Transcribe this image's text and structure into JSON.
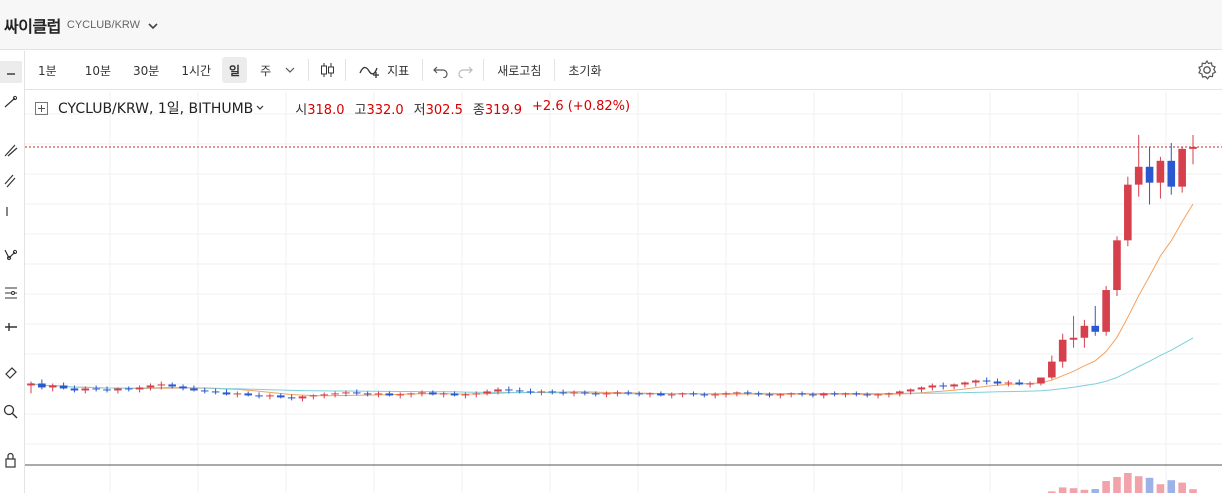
{
  "header": {
    "coin_name": "싸이클럽",
    "pair": "CYCLUB/KRW"
  },
  "toolbar": {
    "intervals": [
      "1분",
      "10분",
      "30분",
      "1시간",
      "일",
      "주"
    ],
    "active_interval": "일",
    "indicator_label": "지표",
    "refresh_label": "새로고침",
    "reset_label": "초기화"
  },
  "legend": {
    "symbol": "CYCLUB/KRW, 1일, BITHUMB",
    "open_label": "시",
    "open": "318.0",
    "high_label": "고",
    "high": "332.0",
    "low_label": "저",
    "low": "302.5",
    "close_label": "종",
    "close": "319.9",
    "change": "+2.6 (+0.82%)"
  },
  "colors": {
    "up": "#d5404c",
    "down": "#2a58d0",
    "ma_short": "#f4a261",
    "ma_long": "#7ecfdb",
    "price_line": "#c62828"
  },
  "chart_data": {
    "type": "candlestick",
    "title": "",
    "xlabel": "",
    "ylabel": "",
    "grid": true,
    "note": "daily OHLC, relative price levels (y axis not labeled in view)",
    "ylim": [
      0,
      340
    ],
    "last_close": 319.9,
    "candles": [
      [
        80,
        84,
        72,
        82
      ],
      [
        82,
        86,
        76,
        78
      ],
      [
        78,
        82,
        74,
        80
      ],
      [
        80,
        83,
        76,
        77
      ],
      [
        77,
        80,
        73,
        75
      ],
      [
        75,
        79,
        72,
        77
      ],
      [
        77,
        80,
        74,
        76
      ],
      [
        76,
        79,
        73,
        75
      ],
      [
        75,
        78,
        72,
        77
      ],
      [
        77,
        79,
        74,
        76
      ],
      [
        76,
        80,
        73,
        78
      ],
      [
        78,
        82,
        75,
        80
      ],
      [
        80,
        84,
        76,
        81
      ],
      [
        81,
        83,
        77,
        79
      ],
      [
        79,
        81,
        75,
        77
      ],
      [
        77,
        80,
        74,
        75
      ],
      [
        75,
        78,
        72,
        74
      ],
      [
        74,
        77,
        71,
        73
      ],
      [
        73,
        76,
        70,
        71
      ],
      [
        71,
        74,
        68,
        72
      ],
      [
        72,
        74,
        69,
        70
      ],
      [
        70,
        73,
        67,
        69
      ],
      [
        69,
        72,
        66,
        70
      ],
      [
        70,
        72,
        67,
        68
      ],
      [
        68,
        71,
        65,
        67
      ],
      [
        67,
        70,
        64,
        69
      ],
      [
        69,
        71,
        66,
        70
      ],
      [
        70,
        73,
        67,
        71
      ],
      [
        71,
        74,
        68,
        72
      ],
      [
        72,
        75,
        69,
        73
      ],
      [
        73,
        76,
        70,
        72
      ],
      [
        72,
        74,
        69,
        71
      ],
      [
        71,
        74,
        68,
        72
      ],
      [
        72,
        74,
        69,
        70
      ],
      [
        70,
        73,
        67,
        71
      ],
      [
        71,
        73,
        68,
        72
      ],
      [
        72,
        75,
        69,
        73
      ],
      [
        73,
        75,
        70,
        71
      ],
      [
        71,
        74,
        68,
        72
      ],
      [
        72,
        74,
        69,
        70
      ],
      [
        70,
        73,
        67,
        71
      ],
      [
        71,
        74,
        68,
        72
      ],
      [
        72,
        76,
        70,
        74
      ],
      [
        74,
        78,
        71,
        76
      ],
      [
        76,
        79,
        72,
        75
      ],
      [
        75,
        78,
        72,
        74
      ],
      [
        74,
        77,
        71,
        73
      ],
      [
        73,
        76,
        70,
        74
      ],
      [
        74,
        76,
        71,
        73
      ],
      [
        73,
        76,
        70,
        72
      ],
      [
        72,
        75,
        69,
        73
      ],
      [
        73,
        75,
        70,
        72
      ],
      [
        72,
        74,
        69,
        71
      ],
      [
        71,
        74,
        68,
        72
      ],
      [
        72,
        75,
        69,
        73
      ],
      [
        73,
        75,
        70,
        72
      ],
      [
        72,
        74,
        69,
        71
      ],
      [
        71,
        73,
        68,
        72
      ],
      [
        72,
        74,
        69,
        70
      ],
      [
        70,
        73,
        67,
        71
      ],
      [
        71,
        73,
        68,
        72
      ],
      [
        72,
        74,
        69,
        71
      ],
      [
        71,
        73,
        68,
        70
      ],
      [
        70,
        73,
        67,
        71
      ],
      [
        71,
        74,
        68,
        72
      ],
      [
        72,
        74,
        69,
        73
      ],
      [
        73,
        75,
        70,
        72
      ],
      [
        72,
        74,
        69,
        71
      ],
      [
        71,
        73,
        68,
        70
      ],
      [
        70,
        72,
        67,
        71
      ],
      [
        71,
        73,
        68,
        72
      ],
      [
        72,
        74,
        69,
        71
      ],
      [
        71,
        73,
        68,
        70
      ],
      [
        70,
        73,
        67,
        72
      ],
      [
        72,
        74,
        69,
        71
      ],
      [
        71,
        73,
        68,
        72
      ],
      [
        72,
        74,
        69,
        71
      ],
      [
        71,
        73,
        68,
        70
      ],
      [
        70,
        72,
        67,
        71
      ],
      [
        71,
        73,
        68,
        72
      ],
      [
        72,
        75,
        69,
        74
      ],
      [
        74,
        77,
        71,
        76
      ],
      [
        76,
        79,
        73,
        78
      ],
      [
        78,
        82,
        75,
        80
      ],
      [
        80,
        83,
        76,
        79
      ],
      [
        79,
        82,
        76,
        81
      ],
      [
        81,
        84,
        78,
        83
      ],
      [
        83,
        86,
        79,
        85
      ],
      [
        85,
        88,
        81,
        84
      ],
      [
        84,
        87,
        80,
        82
      ],
      [
        82,
        85,
        79,
        83
      ],
      [
        83,
        86,
        80,
        81
      ],
      [
        81,
        84,
        78,
        82
      ],
      [
        82,
        86,
        80,
        88
      ],
      [
        88,
        110,
        86,
        104
      ],
      [
        104,
        132,
        98,
        126
      ],
      [
        126,
        150,
        118,
        128
      ],
      [
        128,
        146,
        118,
        140
      ],
      [
        140,
        160,
        130,
        134
      ],
      [
        134,
        180,
        130,
        176
      ],
      [
        176,
        230,
        170,
        226
      ],
      [
        226,
        290,
        220,
        282
      ],
      [
        282,
        332,
        270,
        300
      ],
      [
        300,
        320,
        262,
        284
      ],
      [
        284,
        310,
        268,
        306
      ],
      [
        306,
        324,
        272,
        280
      ],
      [
        280,
        320,
        274,
        318
      ],
      [
        318,
        332,
        302.5,
        319.9
      ]
    ]
  }
}
